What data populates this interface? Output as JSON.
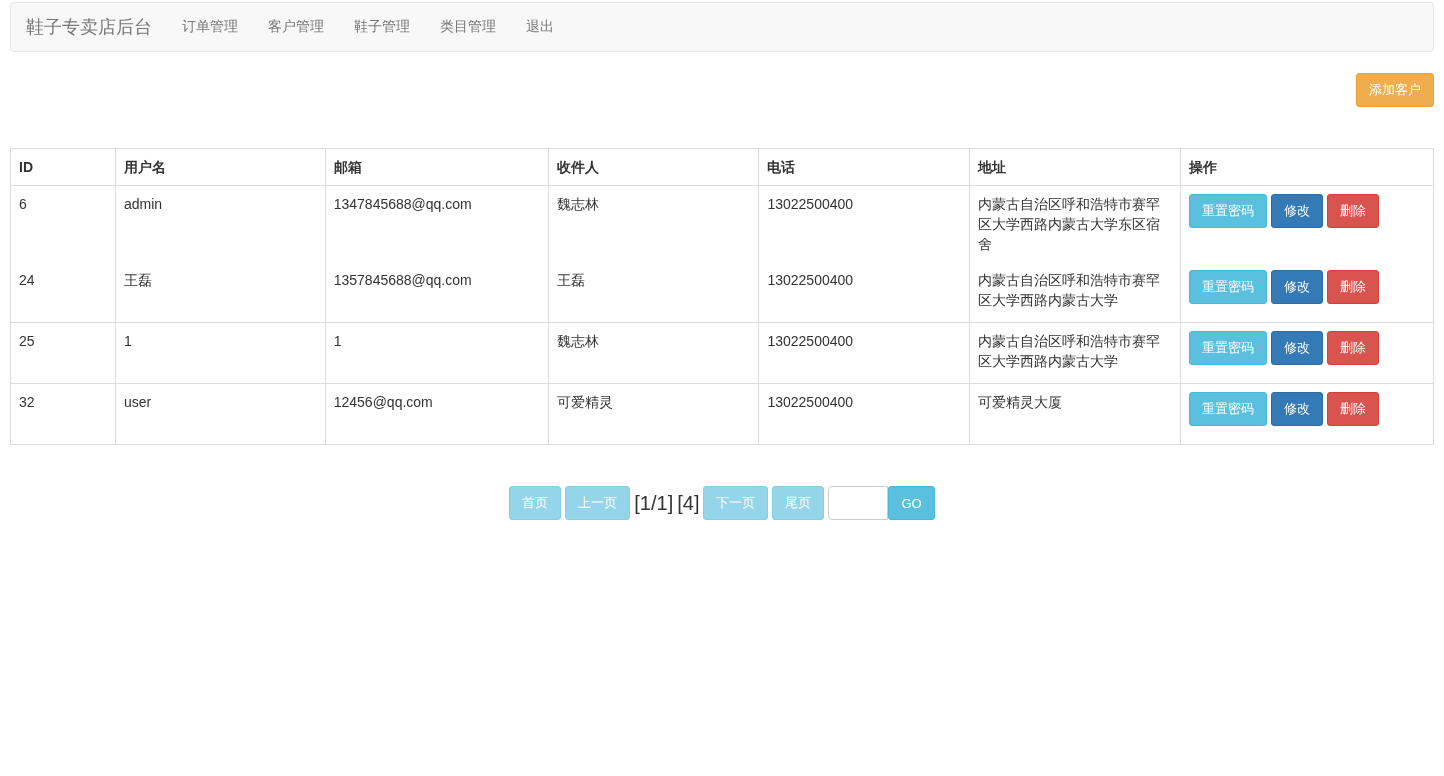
{
  "navbar": {
    "brand": "鞋子专卖店后台",
    "links": [
      "订单管理",
      "客户管理",
      "鞋子管理",
      "类目管理",
      "退出"
    ]
  },
  "add_button": "添加客户",
  "table": {
    "columns": [
      "ID",
      "用户名",
      "邮箱",
      "收件人",
      "电话",
      "地址",
      "操作"
    ],
    "rows": [
      {
        "cells": [
          "6",
          "admin",
          "1347845688@qq.com",
          "魏志林",
          "13022500400",
          "内蒙古自治区呼和浩特市赛罕区大学西路内蒙古大学东区宿舍"
        ],
        "actions": [
          {
            "label": "重置密码",
            "kind": "info"
          },
          {
            "label": "修改",
            "kind": "primary"
          },
          {
            "label": "删除",
            "kind": "danger"
          }
        ]
      },
      {
        "cells": [
          "24",
          "王磊",
          "1357845688@qq.com",
          "王磊",
          "13022500400",
          "内蒙古自治区呼和浩特市赛罕区大学西路内蒙古大学"
        ],
        "actions": [
          {
            "label": "重置密码",
            "kind": "info"
          },
          {
            "label": "修改",
            "kind": "primary"
          },
          {
            "label": "删除",
            "kind": "danger"
          }
        ]
      },
      {
        "cells": [
          "25",
          "1",
          "1",
          "魏志林",
          "13022500400",
          "内蒙古自治区呼和浩特市赛罕区大学西路内蒙古大学"
        ],
        "actions": [
          {
            "label": "重置密码",
            "kind": "info"
          },
          {
            "label": "修改",
            "kind": "primary"
          },
          {
            "label": "删除",
            "kind": "danger"
          }
        ]
      },
      {
        "cells": [
          "32",
          "user",
          "12456@qq.com",
          "可爱精灵",
          "13022500400",
          "可爱精灵大厦"
        ],
        "actions": [
          {
            "label": "重置密码",
            "kind": "info"
          },
          {
            "label": "修改",
            "kind": "primary"
          },
          {
            "label": "删除",
            "kind": "danger"
          }
        ]
      }
    ]
  },
  "pager": {
    "first": {
      "label": "首页",
      "disabled": true
    },
    "prev": {
      "label": "上一页",
      "disabled": true
    },
    "page_info": "[1/1]",
    "total": "[4]",
    "next": {
      "label": "下一页",
      "disabled": true
    },
    "last": {
      "label": "尾页",
      "disabled": true
    },
    "go": {
      "label": "GO",
      "disabled": false
    }
  }
}
